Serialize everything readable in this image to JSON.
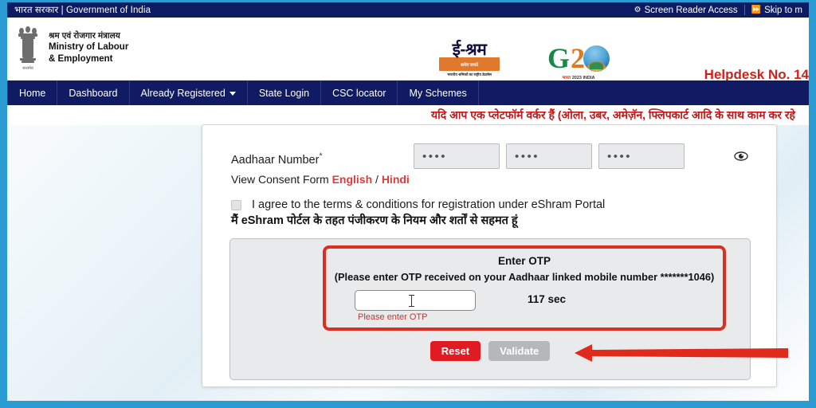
{
  "govbar": {
    "left_text": "भारत सरकार | Government of India",
    "screen_reader": "Screen Reader Access",
    "skip_to": "Skip to m",
    "sr_icon": "accessibility-icon",
    "skip_icon": "fast-forward-icon"
  },
  "header": {
    "ministry_hi": "श्रम एवं रोजगार मंत्रालय",
    "ministry_en_line1": "Ministry of Labour",
    "ministry_en_line2": "& Employment",
    "emblem_icon": "india-state-emblem",
    "eshram_logo": {
      "word": "ई-श्रम",
      "band_text": "श्रमेव जयते",
      "tagline": "भारतीय श्रमिकों का राष्ट्रीय डेटाबेस"
    },
    "g20_logo": {
      "letter_g": "G",
      "letter_2": "2",
      "sub_bharat": "भारत",
      "sub_year": "2023 INDIA"
    },
    "helpdesk": "Helpdesk No. 14"
  },
  "nav": {
    "items": [
      {
        "label": "Home",
        "has_caret": false
      },
      {
        "label": "Dashboard",
        "has_caret": false
      },
      {
        "label": "Already Registered",
        "has_caret": true
      },
      {
        "label": "State Login",
        "has_caret": false
      },
      {
        "label": "CSC locator",
        "has_caret": false
      },
      {
        "label": "My Schemes",
        "has_caret": false
      }
    ]
  },
  "marquee": {
    "text": "यदि आप एक प्लेटफॉर्म वर्कर हैं (ओला, उबर, अमेज़ॅन, फ्लिपकार्ट आदि के साथ काम कर रहे"
  },
  "form": {
    "aadhaar_label": "Aadhaar Number",
    "required_mark": "*",
    "aadhaar_part1": "••••",
    "aadhaar_part2": "••••",
    "aadhaar_part3": "••••",
    "eye_icon": "eye-icon",
    "consent_prefix": "View Consent Form ",
    "consent_english": "English",
    "consent_separator": " / ",
    "consent_hindi": "Hindi",
    "terms_en": "I agree to the terms & conditions for registration under eShram Portal",
    "terms_hi": "मैं eShram पोर्टल के तहत पंजीकरण के नियम और शर्तों से सहमत हूं",
    "checkbox_checked": false
  },
  "otp": {
    "title": "Enter OTP",
    "subtitle": "(Please enter OTP received on your Aadhaar linked mobile number *******1046)",
    "input_value": "",
    "input_placeholder": "",
    "error": "Please enter OTP",
    "timer": "117 sec",
    "reset_label": "Reset",
    "validate_label": "Validate"
  },
  "annotation": {
    "arrow_icon": "left-arrow-annotation",
    "arrow_color": "#e02a1c"
  },
  "colors": {
    "navy": "#101b63",
    "frame_blue": "#2b9bd4",
    "red": "#e11b22",
    "orange": "#e0792c",
    "helpdesk_red": "#d0211c"
  }
}
